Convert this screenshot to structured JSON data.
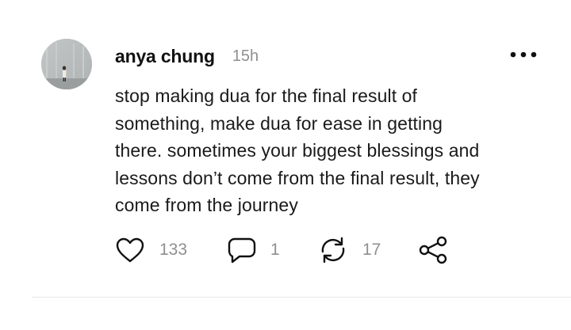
{
  "post": {
    "author": "anya chung",
    "time": "15h",
    "text_lines": [
      "stop making dua for the final result of",
      "something, make dua for ease in getting",
      "there. sometimes your biggest blessings and",
      "lessons don’t come from the final result, they",
      "come from the journey"
    ],
    "actions": {
      "likes": "133",
      "replies": "1",
      "reposts": "17"
    }
  },
  "icons": {
    "more": "more-horizontal-icon",
    "like": "heart-icon",
    "reply": "speech-bubble-icon",
    "repost": "repost-arrows-icon",
    "share": "share-icon"
  },
  "colors": {
    "text": "#111111",
    "secondary": "#8f8f8f",
    "divider": "#e6e6e6"
  }
}
